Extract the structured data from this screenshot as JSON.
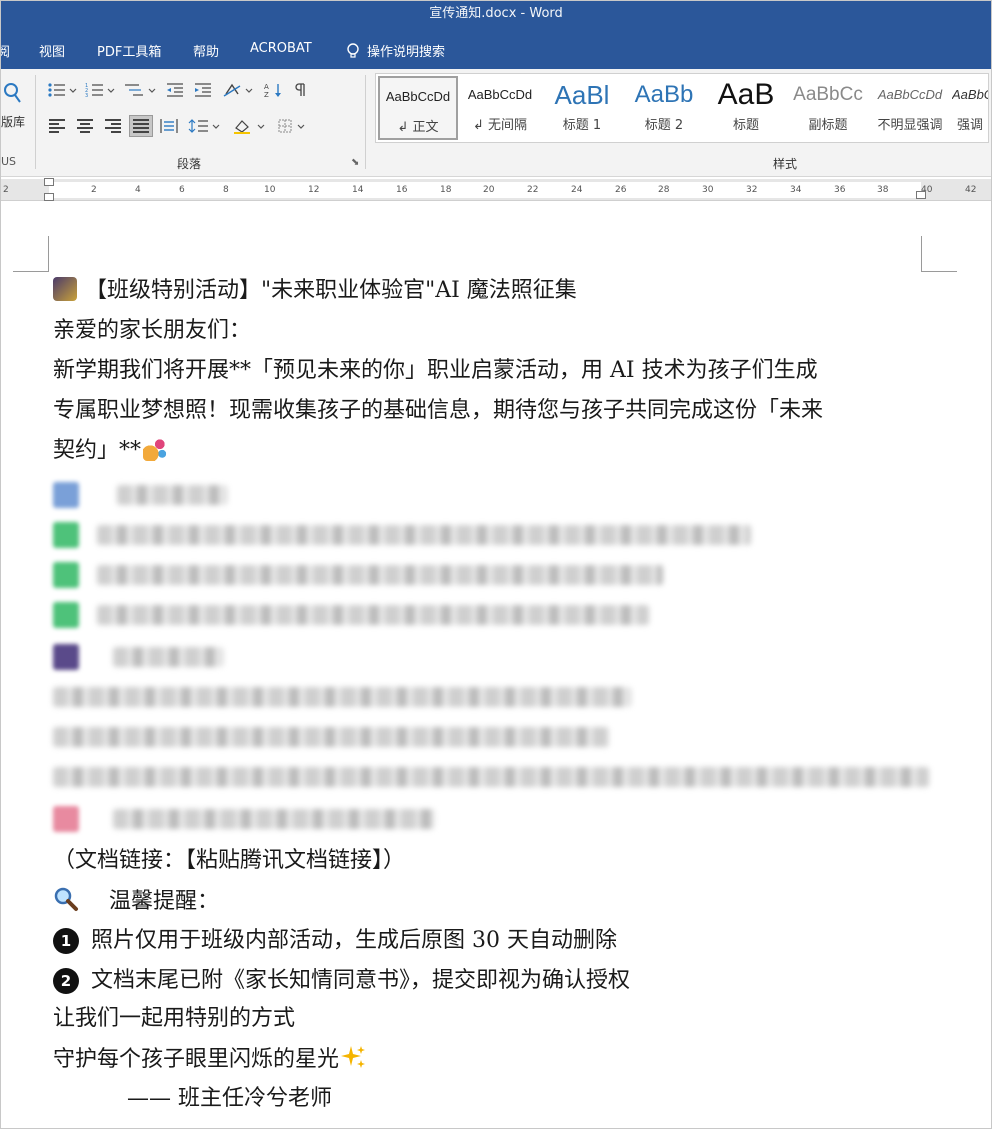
{
  "window": {
    "title": "宣传通知.docx  -  Word"
  },
  "tabs": [
    {
      "label": "阅"
    },
    {
      "label": "视图"
    },
    {
      "label": "PDF工具箱"
    },
    {
      "label": "帮助"
    },
    {
      "label": "ACROBAT"
    },
    {
      "label": "操作说明搜索"
    }
  ],
  "ribbon": {
    "left_group": {
      "label": "版库",
      "caption": "US"
    },
    "paragraph_group_label": "段落",
    "styles_group_label": "样式",
    "styles": [
      {
        "preview": "AaBbCcDd",
        "name": "↲ 正文",
        "selected": true
      },
      {
        "preview": "AaBbCcDd",
        "name": "↲ 无间隔"
      },
      {
        "preview": "AaBl",
        "name": "标题 1"
      },
      {
        "preview": "AaBb",
        "name": "标题 2"
      },
      {
        "preview": "AaB",
        "name": "标题"
      },
      {
        "preview": "AaBbCc",
        "name": "副标题"
      },
      {
        "preview": "AaBbCcDd",
        "name": "不明显强调"
      },
      {
        "preview": "AaBbC",
        "name": "强调"
      }
    ]
  },
  "ruler": {
    "ticks": [
      "2",
      "2",
      "4",
      "6",
      "8",
      "10",
      "12",
      "14",
      "16",
      "18",
      "20",
      "22",
      "24",
      "26",
      "28",
      "30",
      "32",
      "34",
      "36",
      "38",
      "40",
      "42"
    ]
  },
  "document": {
    "heading": "【班级特别活动】\"未来职业体验官\"AI 魔法照征集",
    "greeting": "亲爱的家长朋友们：",
    "intro_1": "新学期我们将开展**「预见未来的你」职业启蒙活动，用 AI 技术为孩子们生成",
    "intro_2": "专属职业梦想照！现需收集孩子的基础信息，期待您与孩子共同完成这份「未来",
    "intro_3": "契约」**",
    "doc_link": "（文档链接：【粘贴腾讯文档链接】）",
    "tip_title": "温馨提醒：",
    "tip_1": "照片仅用于班级内部活动，生成后原图 30 天自动删除",
    "tip_2": "文档末尾已附《家长知情同意书》，提交即视为确认授权",
    "closing_1": "让我们一起用特别的方式",
    "closing_2": "守护每个孩子眼里闪烁的星光",
    "signature": "——  班主任冷兮老师"
  },
  "colors": {
    "brand": "#2b579a",
    "ribbon_bg": "#f3f3f3"
  }
}
